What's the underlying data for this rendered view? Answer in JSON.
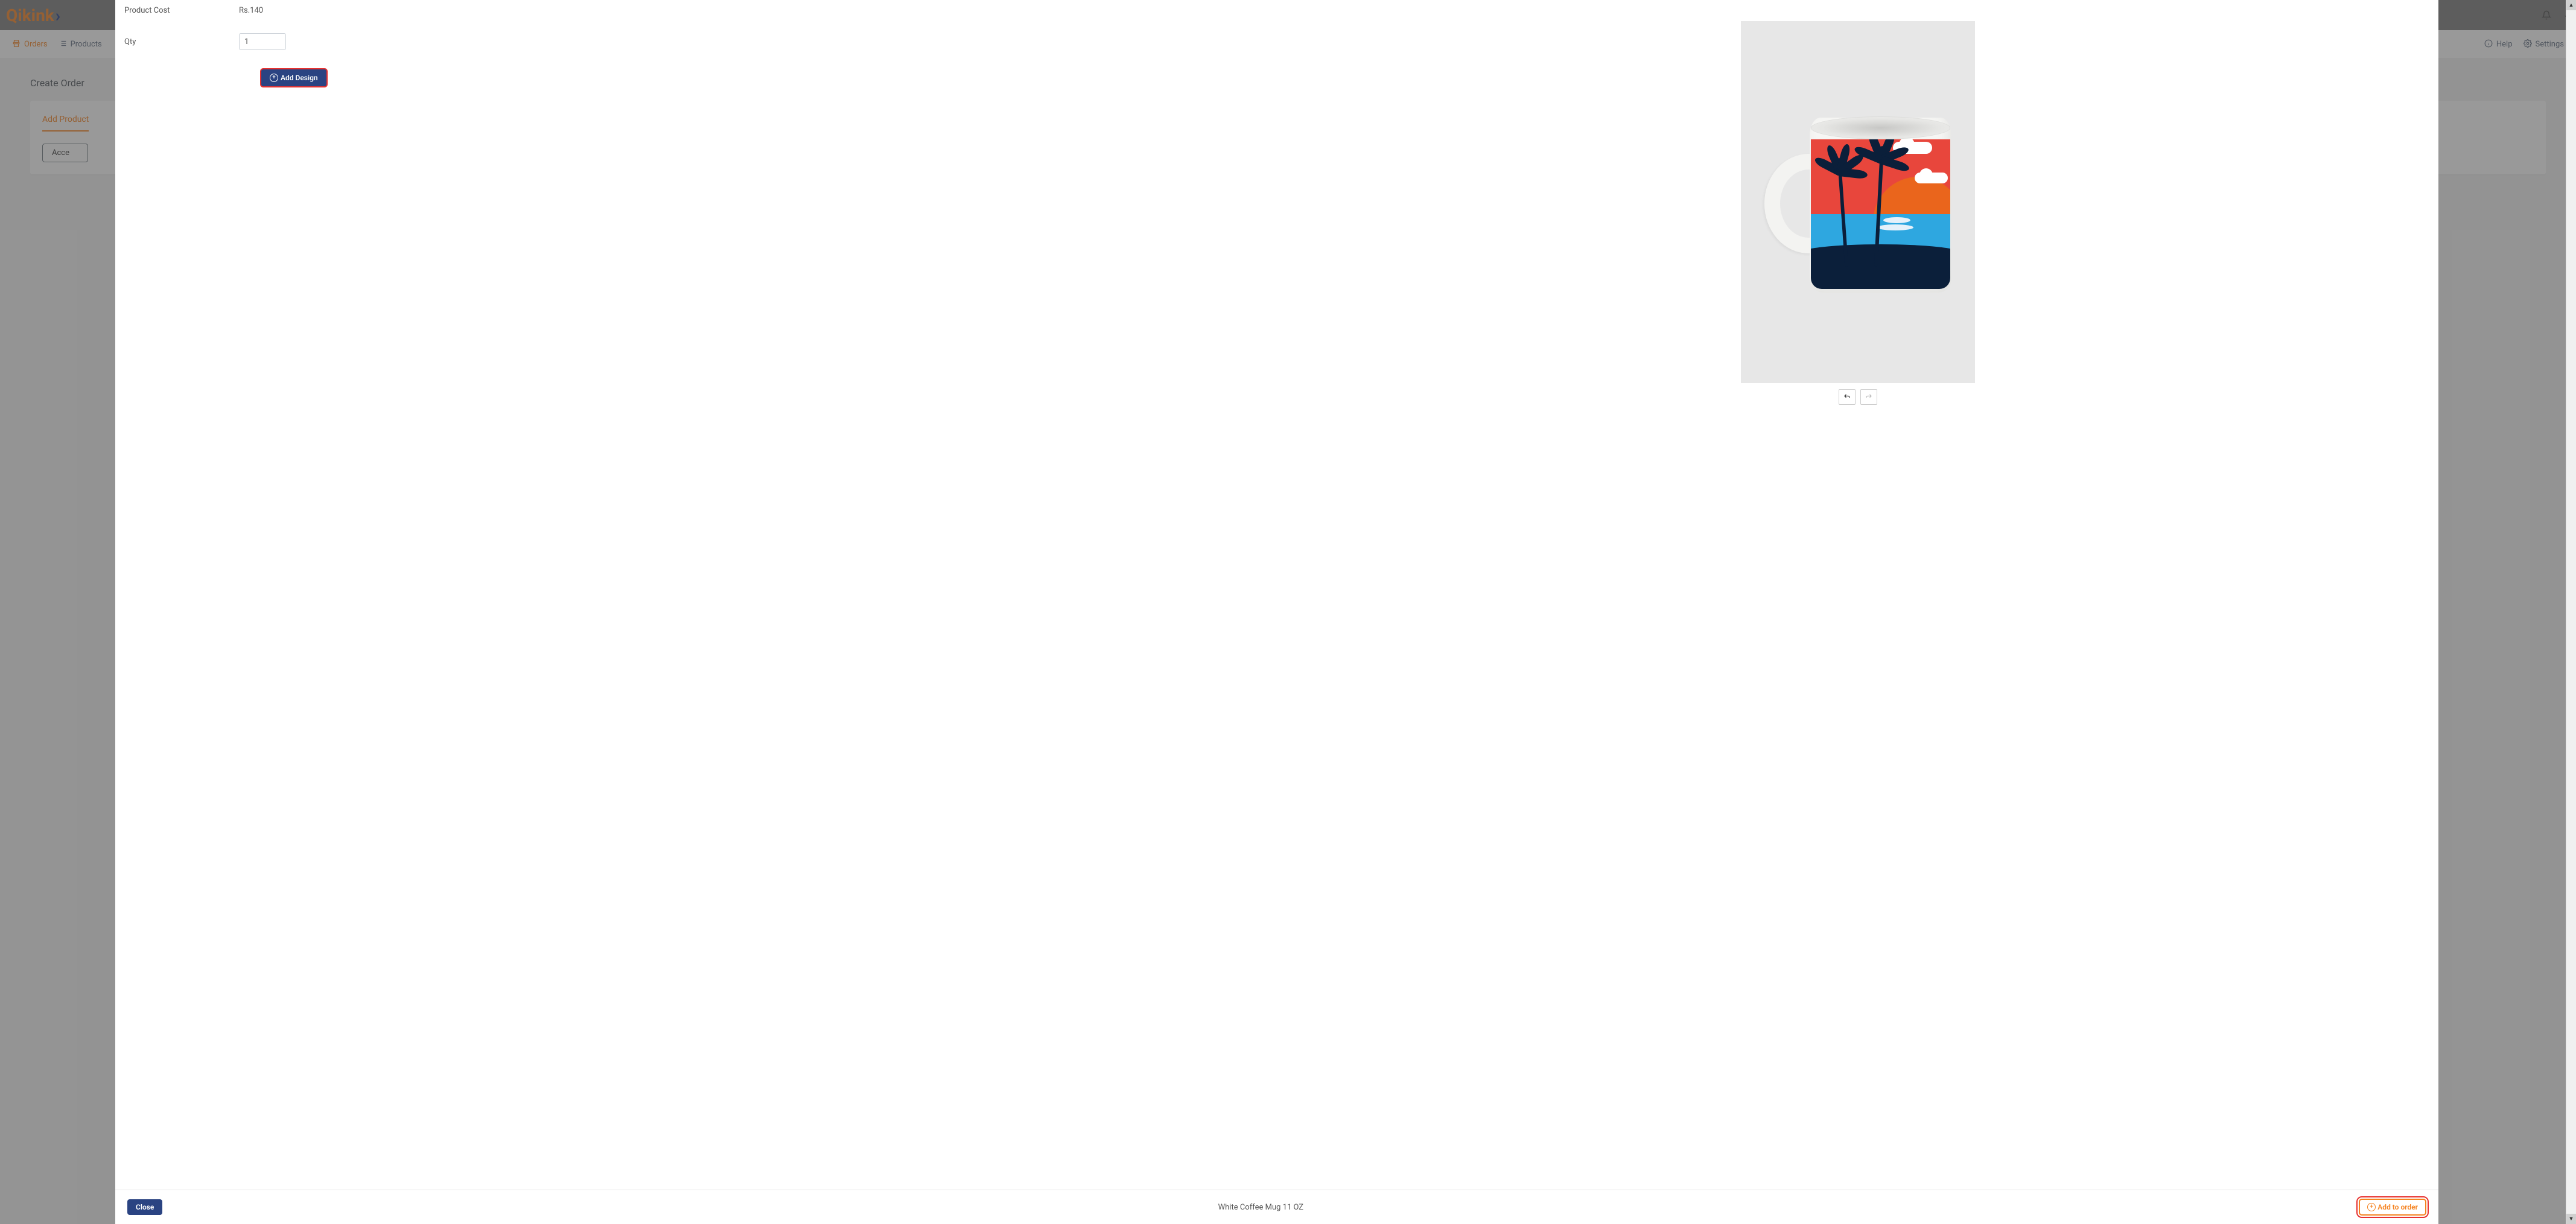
{
  "brand": {
    "name": "Qikink",
    "logo_letters": "Qikink"
  },
  "header": {
    "chevron": "⌄"
  },
  "subnav": {
    "orders": "Orders",
    "products": "Products",
    "help": "Help",
    "settings": "Settings"
  },
  "page": {
    "title": "Create Order",
    "add_product": "Add Product",
    "accessories": "Acce"
  },
  "modal": {
    "product_cost_label": "Product Cost",
    "product_cost_value": "Rs.140",
    "qty_label": "Qty",
    "qty_value": "1",
    "add_design": "Add Design",
    "close": "Close",
    "product_name": "White Coffee Mug 11 OZ",
    "add_to_order": "Add to order"
  }
}
